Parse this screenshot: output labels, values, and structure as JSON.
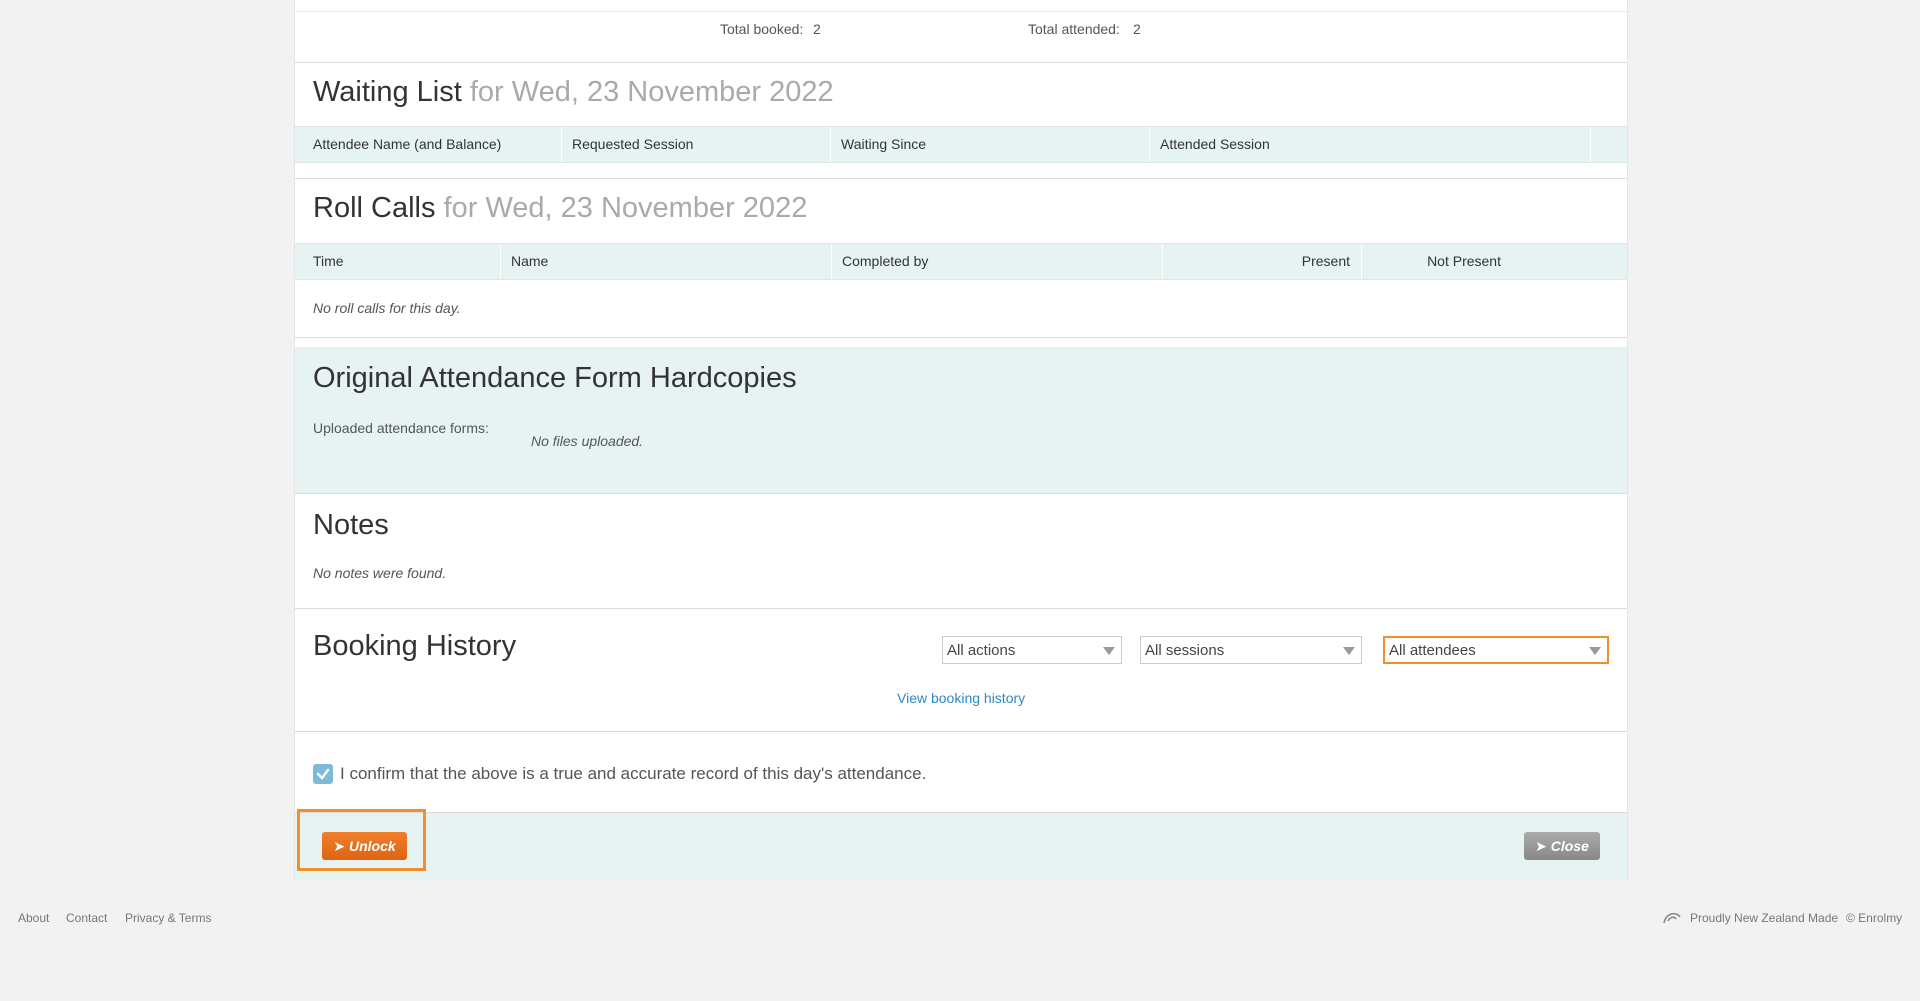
{
  "summary": {
    "total_booked_label": "Total booked:",
    "total_booked_value": "2",
    "total_attended_label": "Total attended:",
    "total_attended_value": "2"
  },
  "waiting_list": {
    "title": "Waiting List",
    "subtitle": "for Wed, 23 November 2022",
    "columns": [
      "Attendee Name (and Balance)",
      "Requested Session",
      "Waiting Since",
      "Attended Session"
    ]
  },
  "roll_calls": {
    "title": "Roll Calls",
    "subtitle": "for Wed, 23 November 2022",
    "columns": [
      "Time",
      "Name",
      "Completed by",
      "Present",
      "Not Present"
    ],
    "empty_text": "No roll calls for this day."
  },
  "hardcopies": {
    "title": "Original Attendance Form Hardcopies",
    "uploaded_label": "Uploaded attendance forms:",
    "empty_text": "No files uploaded."
  },
  "notes": {
    "title": "Notes",
    "empty_text": "No notes were found."
  },
  "booking_history": {
    "title": "Booking History",
    "actions_selected": "All actions",
    "sessions_selected": "All sessions",
    "attendees_selected": "All attendees",
    "view_link": "View booking history"
  },
  "confirm": {
    "checked": true,
    "text": "I confirm that the above is a true and accurate record of this day's attendance."
  },
  "actions": {
    "unlock_label": "Unlock",
    "close_label": "Close"
  },
  "footer": {
    "about": "About",
    "contact": "Contact",
    "privacy": "Privacy & Terms",
    "nz_made": "Proudly New Zealand Made",
    "copyright": "© Enrolmy"
  },
  "colors": {
    "accent_orange": "#e8731f",
    "highlight_orange": "#f0902c",
    "teal_bg": "#e7f3f3",
    "link_blue": "#2a8ac6"
  }
}
